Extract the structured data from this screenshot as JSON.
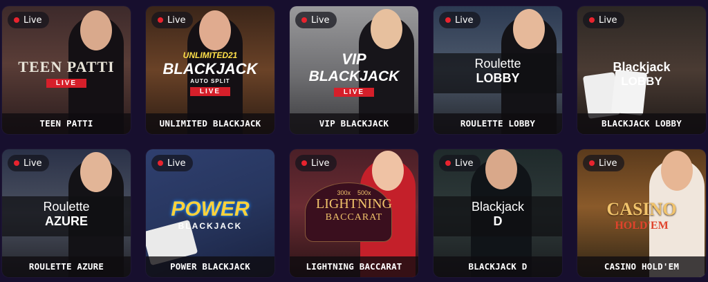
{
  "live_badge": "Live",
  "tiles": [
    {
      "title": "TEEN PATTI",
      "logo_lines": [
        "TEEN PATTI",
        "LIVE"
      ]
    },
    {
      "title": "UNLIMITED BLACKJACK",
      "logo_lines": [
        "UNLIMITED21",
        "BLACKJACK",
        "AUTO SPLIT",
        "LIVE"
      ]
    },
    {
      "title": "VIP BLACKJACK",
      "logo_lines": [
        "VIP",
        "BLACKJACK",
        "LIVE"
      ]
    },
    {
      "title": "ROULETTE LOBBY",
      "logo_lines": [
        "Roulette",
        "LOBBY"
      ]
    },
    {
      "title": "BLACKJACK LOBBY",
      "logo_lines": [
        "Blackjack",
        "LOBBY"
      ]
    },
    {
      "title": "ROULETTE AZURE",
      "logo_lines": [
        "Roulette",
        "AZURE"
      ]
    },
    {
      "title": "POWER BLACKJACK",
      "logo_lines": [
        "POWER",
        "BLACKJACK"
      ]
    },
    {
      "title": "LIGHTNING BACCARAT",
      "logo_lines": [
        "300x",
        "500x",
        "LIGHTNING",
        "BACCARAT"
      ]
    },
    {
      "title": "BLACKJACK D",
      "logo_lines": [
        "Blackjack",
        "D"
      ]
    },
    {
      "title": "CASINO HOLD'EM",
      "logo_lines": [
        "CASINO",
        "HOLD'EM"
      ]
    }
  ],
  "colors": {
    "page_bg": "#170f2e",
    "live_dot": "#e8232e",
    "live_bar": "#d61f2a",
    "power_blue": "#1f8cff",
    "gold": "#f1c36b"
  }
}
